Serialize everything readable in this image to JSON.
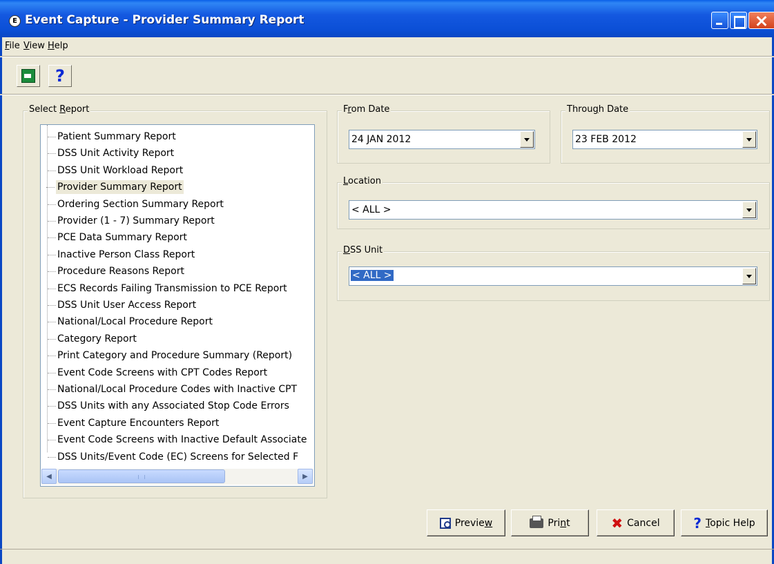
{
  "window": {
    "title": "Event Capture - Provider Summary Report",
    "icon_letter": "E"
  },
  "menu": [
    {
      "key": "F",
      "rest": "ile"
    },
    {
      "key": "V",
      "rest": "iew"
    },
    {
      "key": "H",
      "rest": "elp"
    }
  ],
  "toolbar": {
    "exit_icon": "exit-icon",
    "help_glyph": "?"
  },
  "select_report": {
    "legend_pre": "Select ",
    "legend_key": "R",
    "legend_post": "eport",
    "items": [
      "Patient Summary Report",
      "DSS Unit Activity Report",
      "DSS Unit Workload Report",
      "Provider Summary Report",
      "Ordering Section Summary Report",
      "Provider (1 - 7) Summary Report",
      "PCE Data Summary Report",
      "Inactive Person Class Report",
      "Procedure Reasons Report",
      "ECS Records Failing Transmission to PCE Report",
      "DSS Unit User Access Report",
      "National/Local Procedure Report",
      "Category Report",
      "Print Category and Procedure Summary (Report)",
      "Event Code Screens with CPT Codes Report",
      "National/Local Procedure Codes with Inactive CPT",
      "DSS Units with any Associated Stop Code Errors",
      "Event Capture Encounters Report",
      "Event Code Screens with Inactive Default Associate",
      "DSS Units/Event Code (EC) Screens for Selected F"
    ],
    "selected_index": 3
  },
  "from_date": {
    "legend_pre": "F",
    "legend_key": "r",
    "legend_post": "om Date",
    "value": "24 JAN 2012"
  },
  "through_date": {
    "legend_pre": "Throu",
    "legend_key": "g",
    "legend_post": "h Date",
    "value": "23 FEB 2012"
  },
  "location": {
    "legend_key": "L",
    "legend_post": "ocation",
    "value": "< ALL >"
  },
  "dss_unit": {
    "legend_key": "D",
    "legend_post": "SS Unit",
    "value": "< ALL >"
  },
  "buttons": {
    "preview_pre": "Previe",
    "preview_key": "w",
    "print_pre": "Pri",
    "print_key": "n",
    "print_post": "t",
    "cancel": "Cancel",
    "help_key": "T",
    "help_post": "opic Help"
  },
  "colors": {
    "titlebar": "#0a47c4",
    "window_bg": "#ece9d8",
    "selection": "#316ac5"
  }
}
